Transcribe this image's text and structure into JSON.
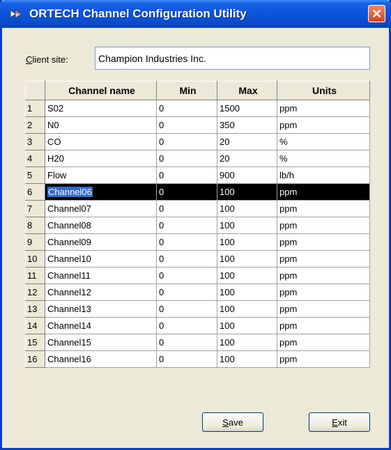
{
  "window": {
    "title": "ORTECH Channel Configuration Utility",
    "close_glyph": "✕"
  },
  "client": {
    "label_mnemonic": "C",
    "label_rest": "lient site:",
    "value": "Champion Industries Inc."
  },
  "table": {
    "columns": [
      "Channel name",
      "Min",
      "Max",
      "Units"
    ],
    "selected_row": 6,
    "rows": [
      {
        "num": "1",
        "name": "S02",
        "min": "0",
        "max": "1500",
        "units": "ppm"
      },
      {
        "num": "2",
        "name": "N0",
        "min": "0",
        "max": "350",
        "units": "ppm"
      },
      {
        "num": "3",
        "name": "CO",
        "min": "0",
        "max": "20",
        "units": "%"
      },
      {
        "num": "4",
        "name": "H20",
        "min": "0",
        "max": "20",
        "units": "%"
      },
      {
        "num": "5",
        "name": "Flow",
        "min": "0",
        "max": "900",
        "units": "lb/h"
      },
      {
        "num": "6",
        "name": "Channel06",
        "min": "0",
        "max": "100",
        "units": "ppm"
      },
      {
        "num": "7",
        "name": "Channel07",
        "min": "0",
        "max": "100",
        "units": "ppm"
      },
      {
        "num": "8",
        "name": "Channel08",
        "min": "0",
        "max": "100",
        "units": "ppm"
      },
      {
        "num": "9",
        "name": "Channel09",
        "min": "0",
        "max": "100",
        "units": "ppm"
      },
      {
        "num": "10",
        "name": "Channel10",
        "min": "0",
        "max": "100",
        "units": "ppm"
      },
      {
        "num": "11",
        "name": "Channel11",
        "min": "0",
        "max": "100",
        "units": "ppm"
      },
      {
        "num": "12",
        "name": "Channel12",
        "min": "0",
        "max": "100",
        "units": "ppm"
      },
      {
        "num": "13",
        "name": "Channel13",
        "min": "0",
        "max": "100",
        "units": "ppm"
      },
      {
        "num": "14",
        "name": "Channel14",
        "min": "0",
        "max": "100",
        "units": "ppm"
      },
      {
        "num": "15",
        "name": "Channel15",
        "min": "0",
        "max": "100",
        "units": "ppm"
      },
      {
        "num": "16",
        "name": "Channel16",
        "min": "0",
        "max": "100",
        "units": "ppm"
      }
    ]
  },
  "buttons": {
    "save": {
      "mnemonic": "S",
      "rest": "ave"
    },
    "exit": {
      "mnemonic": "E",
      "rest": "xit"
    }
  },
  "icons": {
    "app": "ortech-app-icon",
    "close": "close-icon"
  }
}
